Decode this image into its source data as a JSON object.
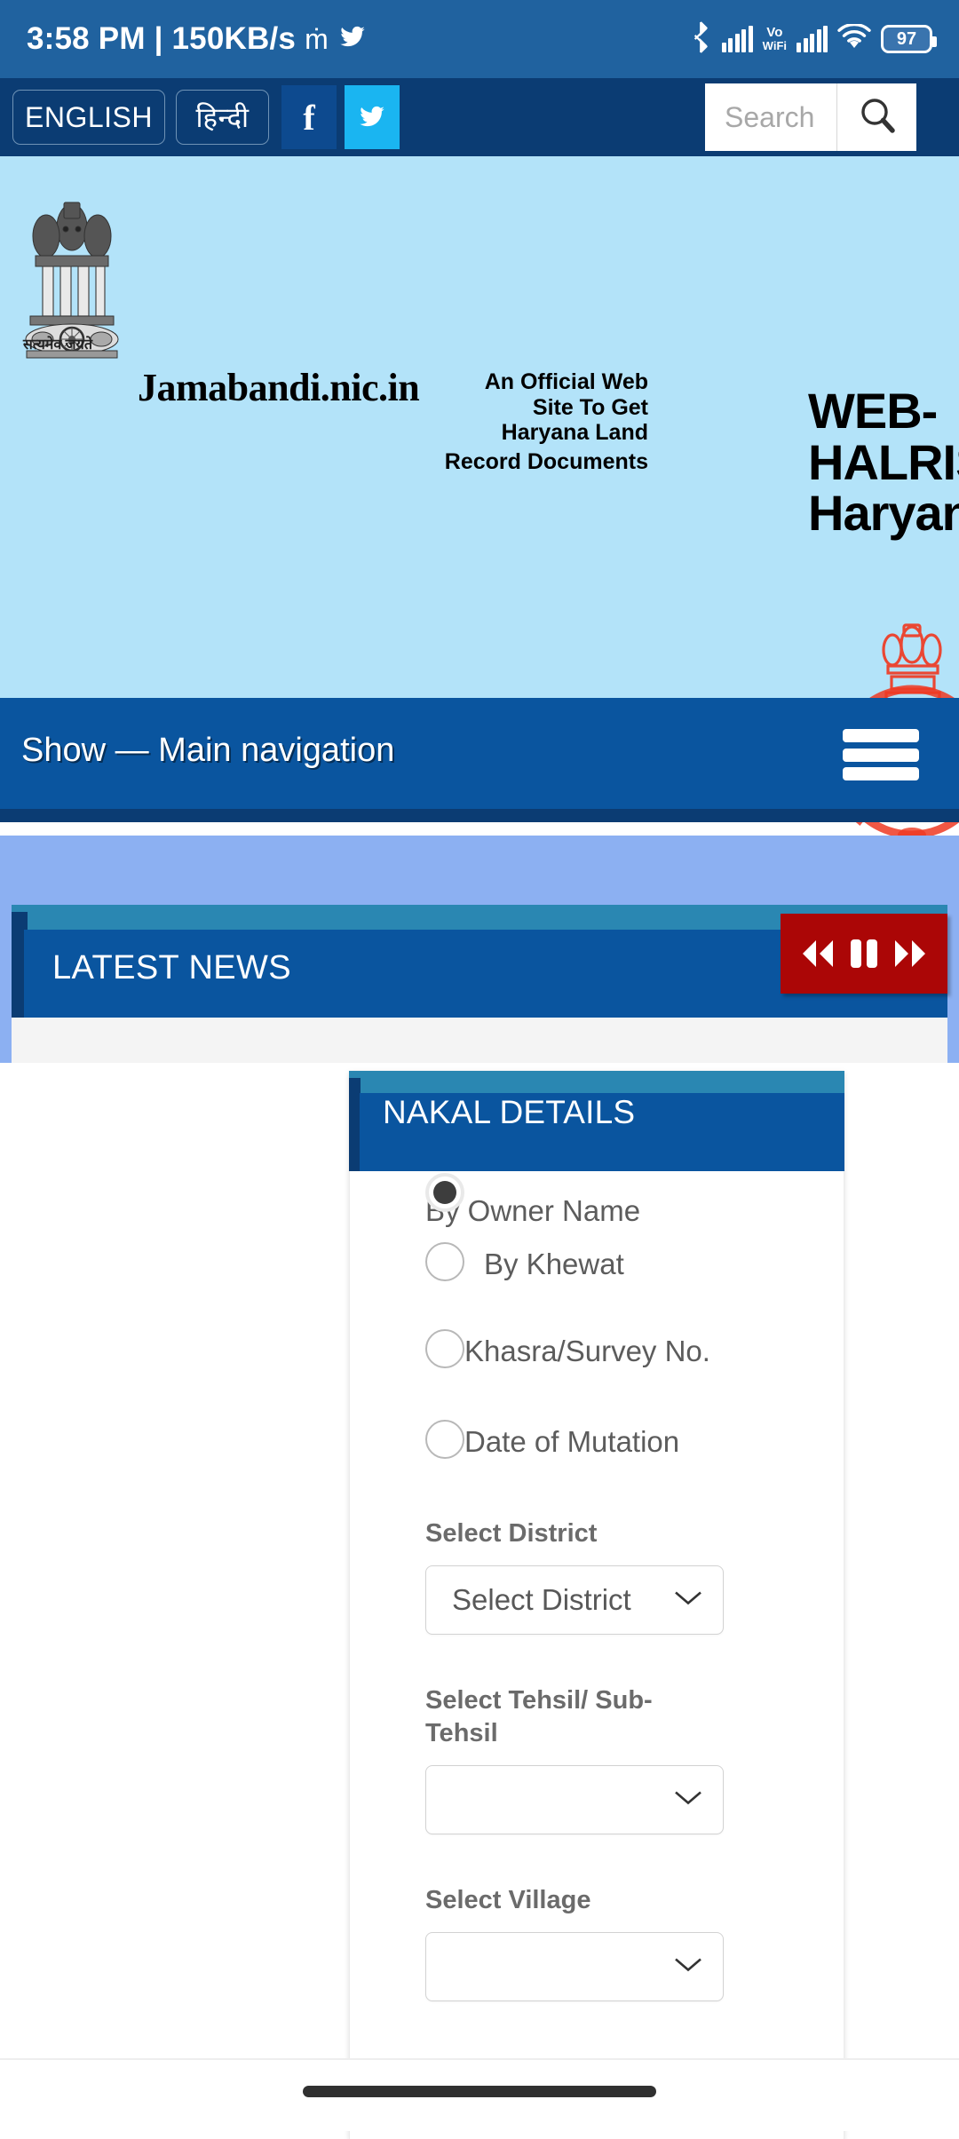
{
  "statusbar": {
    "clock": "3:58 PM | 150KB/s",
    "network_icon": "network-speed-icon",
    "twitter_icon": "twitter-icon",
    "bluetooth_icon": "bluetooth-icon",
    "signal_icon": "cellular-signal-icon",
    "volte_line1": "Vo",
    "volte_line2": "WiFi",
    "signal2_icon": "cellular-signal-2-icon",
    "wifi_icon": "wifi-icon",
    "battery_level": "97"
  },
  "topbar": {
    "english_label": "ENGLISH",
    "hindi_label": "हिन्दी",
    "facebook_label": "f",
    "facebook_icon": "facebook-icon",
    "twitter_icon": "twitter-icon",
    "search_placeholder": "Search",
    "search_value": "",
    "search_icon": "search-icon"
  },
  "banner": {
    "emblem_icon": "india-state-emblem-icon",
    "emblem_caption": "सत्यमेव जयते",
    "site_title": "Jamabandi.nic.in",
    "site_subtitle_line1": "An Official Web",
    "site_subtitle_line2": "Site To Get",
    "site_subtitle_line3": "Haryana Land",
    "site_subtitle_line4": "Record Documents",
    "webhalris_line1": "WEB-",
    "webhalris_line2": "HALRIS",
    "webhalris_line3": "Haryana",
    "haryana_emblem_icon": "govt-of-haryana-emblem-icon"
  },
  "navbar": {
    "label": "Show — Main navigation",
    "menu_icon": "hamburger-menu-icon"
  },
  "news": {
    "title": "LATEST NEWS",
    "prev_icon": "rewind-icon",
    "pause_icon": "pause-icon",
    "next_icon": "fast-forward-icon",
    "ticker_text": ""
  },
  "nakal": {
    "panel_title": "NAKAL DETAILS",
    "radio_options": [
      {
        "label": "By Owner Name",
        "checked": true
      },
      {
        "label": "By Khewat",
        "checked": false
      },
      {
        "label": "Khasra/Survey No.",
        "checked": false
      },
      {
        "label": "Date of Mutation",
        "checked": false
      }
    ],
    "fields": [
      {
        "label": "Select District",
        "value": "Select District",
        "chevron_icon": "chevron-down-icon"
      },
      {
        "label": "Select Tehsil/ Sub-Tehsil",
        "value": "",
        "chevron_icon": "chevron-down-icon"
      },
      {
        "label": "Select Village",
        "value": "",
        "chevron_icon": "chevron-down-icon"
      }
    ]
  },
  "system": {
    "gesture_bar": "gesture-bar"
  },
  "colors": {
    "status_blue": "#20629f",
    "topbar_blue": "#0b3c73",
    "banner_blue": "#b3e3f9",
    "nav_blue": "#0a559f",
    "news_bg": "#8cb0f2",
    "ctrl_red": "#ab0606",
    "panel_top": "#2a87b2"
  }
}
